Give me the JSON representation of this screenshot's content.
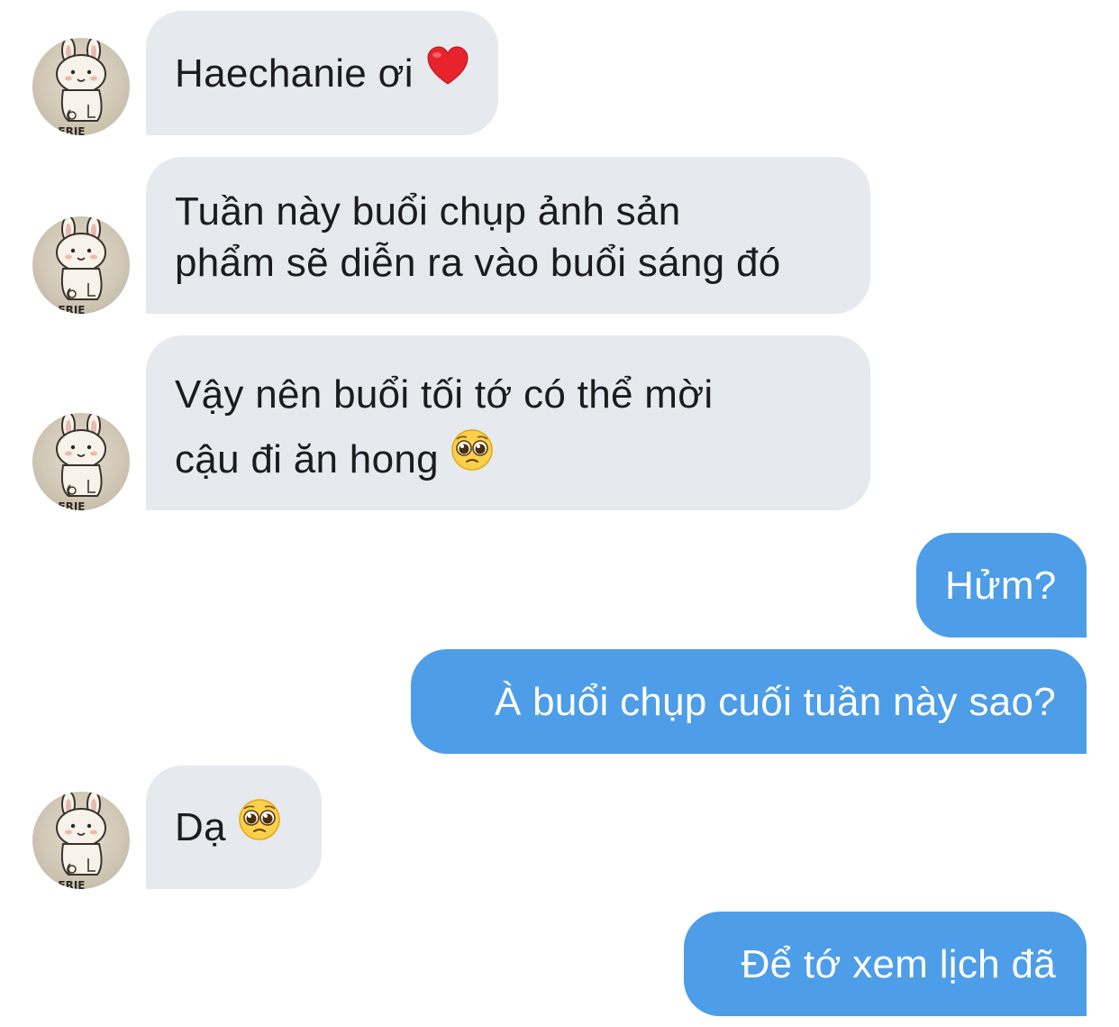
{
  "messages": [
    {
      "side": "in",
      "lines": [
        "Haechanie ơi"
      ],
      "emoji": "heart-icon"
    },
    {
      "side": "in",
      "lines": [
        "Tuần này buổi chụp ảnh sản",
        "phẩm sẽ diễn ra vào buổi sáng đó"
      ]
    },
    {
      "side": "in",
      "lines": [
        "Vậy nên buổi tối tớ có thể mời",
        "cậu đi ăn hong"
      ],
      "emoji": "pleading-face-icon"
    },
    {
      "side": "out",
      "lines": [
        "Hửm?"
      ]
    },
    {
      "side": "out",
      "lines": [
        "À buổi chụp cuối tuần này sao?"
      ]
    },
    {
      "side": "in",
      "lines": [
        "Dạ"
      ],
      "emoji": "pleading-face-icon"
    },
    {
      "side": "out",
      "lines": [
        "Để tớ xem lịch đã"
      ]
    }
  ],
  "colors": {
    "incoming_bubble": "#e6e9ee",
    "outgoing_bubble": "#4d9de8",
    "incoming_text": "#1c1c1e",
    "outgoing_text": "#ffffff"
  },
  "avatar_icon": "bunny-sticker-icon"
}
